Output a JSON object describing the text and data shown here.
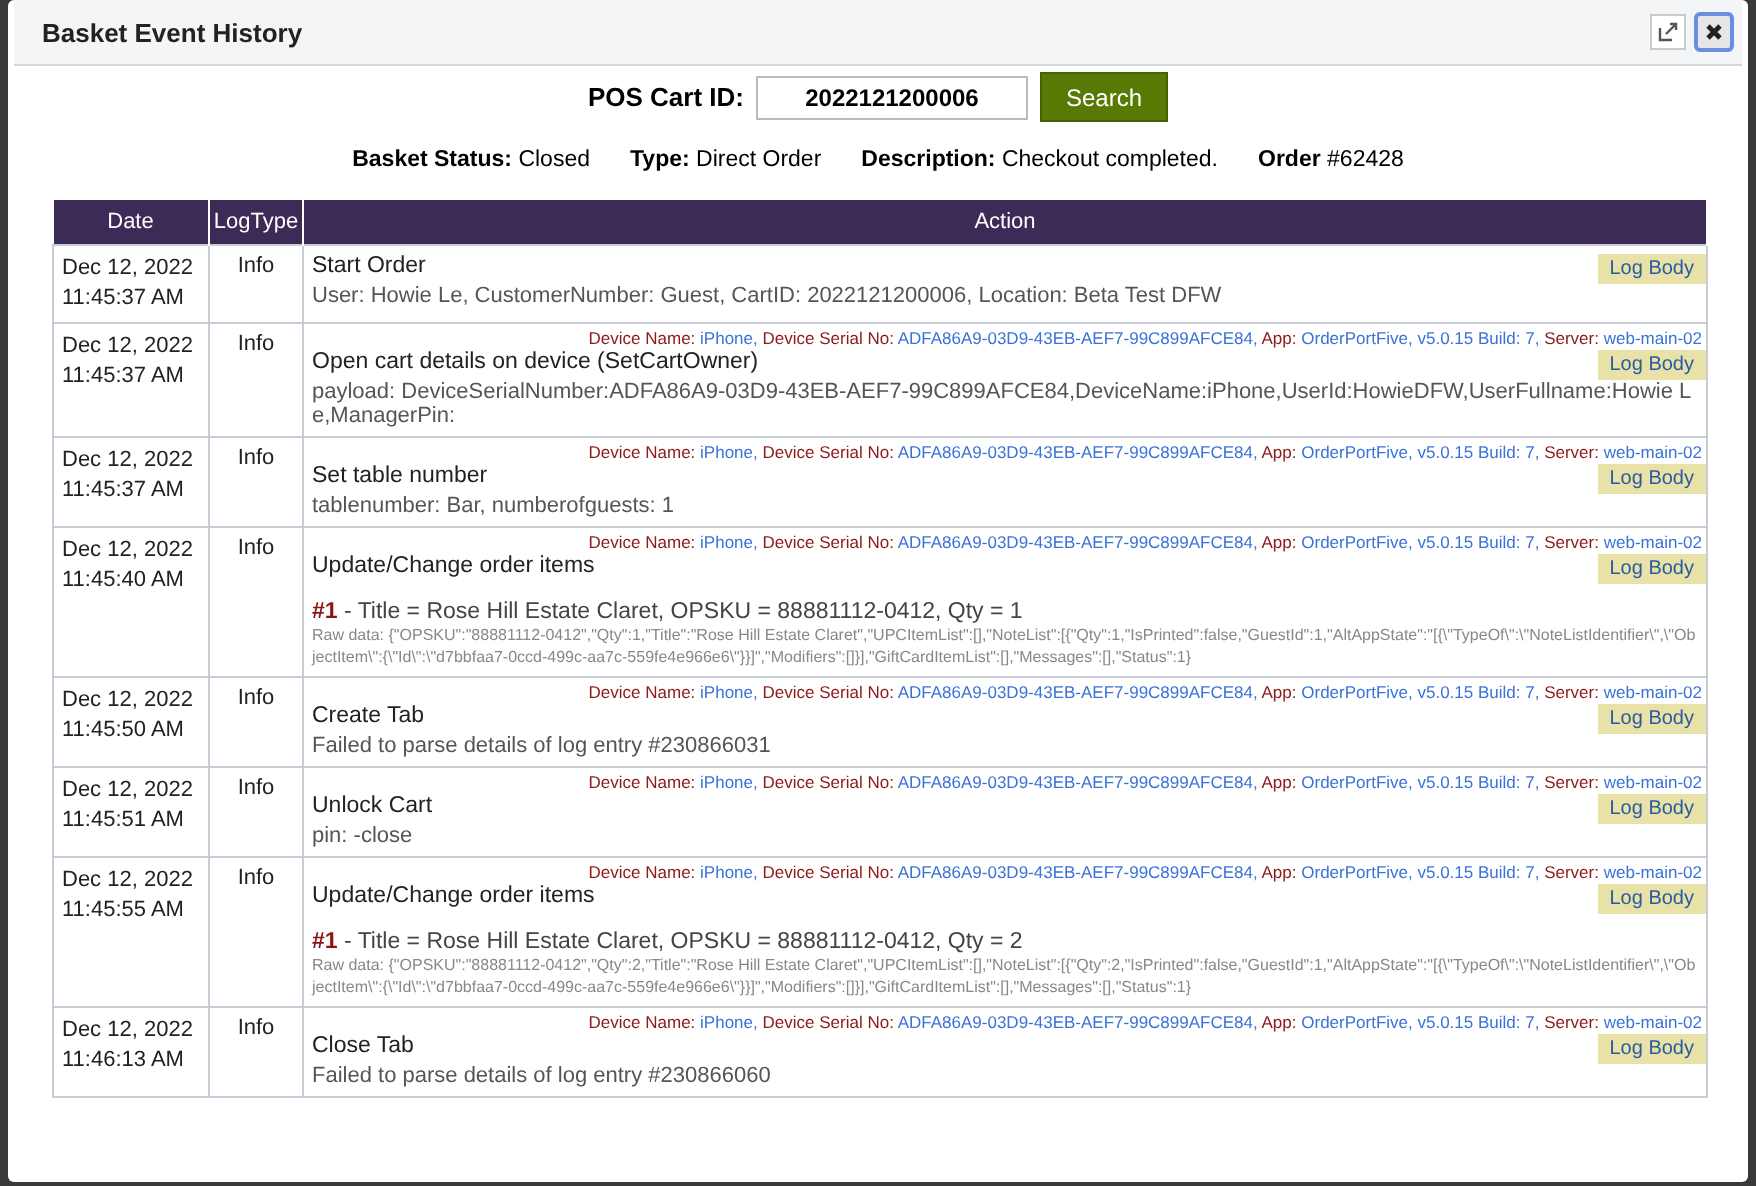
{
  "window": {
    "title": "Basket Event History"
  },
  "search": {
    "label": "POS Cart ID:",
    "value": "2022121200006",
    "button": "Search"
  },
  "summary": [
    {
      "label": "Basket Status:",
      "value": "Closed"
    },
    {
      "label": "Type:",
      "value": "Direct Order"
    },
    {
      "label": "Description:",
      "value": "Checkout completed."
    },
    {
      "label": "Order",
      "value": "#62428"
    }
  ],
  "table": {
    "columns": [
      "Date",
      "LogType",
      "Action"
    ],
    "rows": [
      {
        "date": "Dec 12, 2022",
        "time": "11:45:37 AM",
        "log_type": "Info",
        "title": "Start Order",
        "button": "Log Body",
        "kind": "text",
        "detail": "User: Howie Le, CustomerNumber: Guest, CartID: 2022121200006, Location: Beta Test DFW"
      },
      {
        "date": "Dec 12, 2022",
        "time": "11:45:37 AM",
        "log_type": "Info",
        "title": "Open cart details on device (SetCartOwner)",
        "button": "Log Body",
        "device": [
          {
            "label": "Device Name:",
            "value": "iPhone,"
          },
          {
            "label": "Device Serial No:",
            "value": "ADFA86A9-03D9-43EB-AEF7-99C899AFCE84,"
          },
          {
            "label": "App:",
            "value": "OrderPortFive, v5.0.15 Build: 7,"
          },
          {
            "label": "Server:",
            "value": "web-main-02"
          }
        ],
        "kind": "text",
        "detail": "payload: DeviceSerialNumber:ADFA86A9-03D9-43EB-AEF7-99C899AFCE84,DeviceName:iPhone,UserId:HowieDFW,UserFullname:Howie Le,ManagerPin:"
      },
      {
        "date": "Dec 12, 2022",
        "time": "11:45:37 AM",
        "log_type": "Info",
        "title": "Set table number",
        "button": "Log Body",
        "device": [
          {
            "label": "Device Name:",
            "value": "iPhone,"
          },
          {
            "label": "Device Serial No:",
            "value": "ADFA86A9-03D9-43EB-AEF7-99C899AFCE84,"
          },
          {
            "label": "App:",
            "value": "OrderPortFive, v5.0.15 Build: 7,"
          },
          {
            "label": "Server:",
            "value": "web-main-02"
          }
        ],
        "kind": "text",
        "detail": "tablenumber: Bar, numberofguests: 1"
      },
      {
        "date": "Dec 12, 2022",
        "time": "11:45:40 AM",
        "log_type": "Info",
        "title": "Update/Change order items",
        "button": "Log Body",
        "device": [
          {
            "label": "Device Name:",
            "value": "iPhone,"
          },
          {
            "label": "Device Serial No:",
            "value": "ADFA86A9-03D9-43EB-AEF7-99C899AFCE84,"
          },
          {
            "label": "App:",
            "value": "OrderPortFive, v5.0.15 Build: 7,"
          },
          {
            "label": "Server:",
            "value": "web-main-02"
          }
        ],
        "kind": "item",
        "item_number": "#1",
        "detail": "- Title = Rose Hill Estate Claret, OPSKU = 88881112-0412, Qty = 1",
        "raw": "Raw data: {\"OPSKU\":\"88881112-0412\",\"Qty\":1,\"Title\":\"Rose Hill Estate Claret\",\"UPCItemList\":[],\"NoteList\":[{\"Qty\":1,\"IsPrinted\":false,\"GuestId\":1,\"AltAppState\":\"[{\\\"TypeOf\\\":\\\"NoteListIdentifier\\\",\\\"ObjectItem\\\":{\\\"Id\\\":\\\"d7bbfaa7-0ccd-499c-aa7c-559fe4e966e6\\\"}}]\",\"Modifiers\":[]}],\"GiftCardItemList\":[],\"Messages\":[],\"Status\":1}"
      },
      {
        "date": "Dec 12, 2022",
        "time": "11:45:50 AM",
        "log_type": "Info",
        "title": "Create Tab",
        "button": "Log Body",
        "device": [
          {
            "label": "Device Name:",
            "value": "iPhone,"
          },
          {
            "label": "Device Serial No:",
            "value": "ADFA86A9-03D9-43EB-AEF7-99C899AFCE84,"
          },
          {
            "label": "App:",
            "value": "OrderPortFive, v5.0.15 Build: 7,"
          },
          {
            "label": "Server:",
            "value": "web-main-02"
          }
        ],
        "kind": "text",
        "detail": "Failed to parse details of log entry #230866031"
      },
      {
        "date": "Dec 12, 2022",
        "time": "11:45:51 AM",
        "log_type": "Info",
        "title": "Unlock Cart",
        "button": "Log Body",
        "device": [
          {
            "label": "Device Name:",
            "value": "iPhone,"
          },
          {
            "label": "Device Serial No:",
            "value": "ADFA86A9-03D9-43EB-AEF7-99C899AFCE84,"
          },
          {
            "label": "App:",
            "value": "OrderPortFive, v5.0.15 Build: 7,"
          },
          {
            "label": "Server:",
            "value": "web-main-02"
          }
        ],
        "kind": "text",
        "detail": "pin: -close"
      },
      {
        "date": "Dec 12, 2022",
        "time": "11:45:55 AM",
        "log_type": "Info",
        "title": "Update/Change order items",
        "button": "Log Body",
        "device": [
          {
            "label": "Device Name:",
            "value": "iPhone,"
          },
          {
            "label": "Device Serial No:",
            "value": "ADFA86A9-03D9-43EB-AEF7-99C899AFCE84,"
          },
          {
            "label": "App:",
            "value": "OrderPortFive, v5.0.15 Build: 7,"
          },
          {
            "label": "Server:",
            "value": "web-main-02"
          }
        ],
        "kind": "item",
        "item_number": "#1",
        "detail": "- Title = Rose Hill Estate Claret, OPSKU = 88881112-0412, Qty = 2",
        "raw": "Raw data: {\"OPSKU\":\"88881112-0412\",\"Qty\":2,\"Title\":\"Rose Hill Estate Claret\",\"UPCItemList\":[],\"NoteList\":[{\"Qty\":2,\"IsPrinted\":false,\"GuestId\":1,\"AltAppState\":\"[{\\\"TypeOf\\\":\\\"NoteListIdentifier\\\",\\\"ObjectItem\\\":{\\\"Id\\\":\\\"d7bbfaa7-0ccd-499c-aa7c-559fe4e966e6\\\"}}]\",\"Modifiers\":[]}],\"GiftCardItemList\":[],\"Messages\":[],\"Status\":1}"
      },
      {
        "date": "Dec 12, 2022",
        "time": "11:46:13 AM",
        "log_type": "Info",
        "title": "Close Tab",
        "button": "Log Body",
        "device": [
          {
            "label": "Device Name:",
            "value": "iPhone,"
          },
          {
            "label": "Device Serial No:",
            "value": "ADFA86A9-03D9-43EB-AEF7-99C899AFCE84,"
          },
          {
            "label": "App:",
            "value": "OrderPortFive, v5.0.15 Build: 7,"
          },
          {
            "label": "Server:",
            "value": "web-main-02"
          }
        ],
        "kind": "text",
        "detail": "Failed to parse details of log entry #230866060"
      }
    ]
  }
}
